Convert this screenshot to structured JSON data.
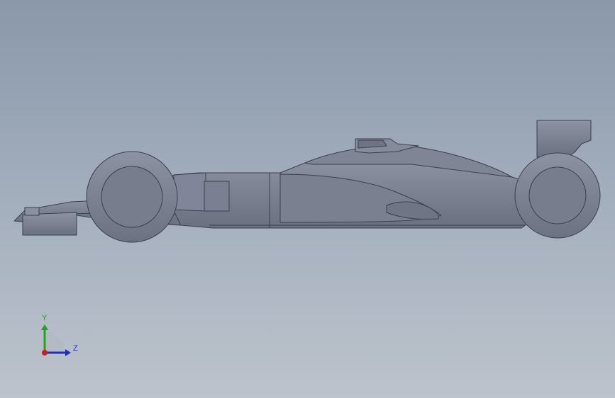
{
  "viewport": {
    "background_top": "#8a98aa",
    "background_bottom": "#bcc3cc",
    "model_fill": "#7b8191",
    "model_edge": "#3a3f4e"
  },
  "triad": {
    "y_label": "Y",
    "z_label": "Z",
    "y_color": "#22a322",
    "z_color": "#1f2fbf",
    "x_color": "#d01c1c"
  }
}
